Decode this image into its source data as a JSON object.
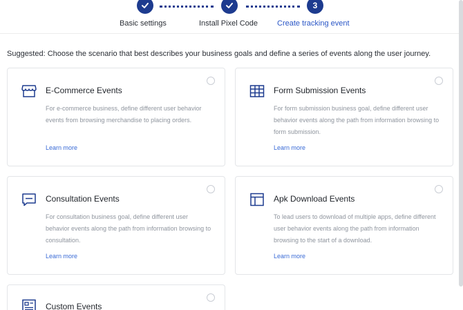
{
  "stepper": {
    "steps": [
      {
        "label": "Basic settings",
        "state": "done"
      },
      {
        "label": "Install Pixel Code",
        "state": "done"
      },
      {
        "label": "Create tracking event",
        "state": "active",
        "number": "3"
      }
    ]
  },
  "suggestion": "Suggested: Choose the scenario that best describes your business goals and define a series of events along the user journey.",
  "cards": [
    {
      "icon": "storefront-icon",
      "title": "E-Commerce Events",
      "description": "For e-commerce business, define different user behavior events from browsing merchandise to placing orders.",
      "learn_more": "Learn more"
    },
    {
      "icon": "table-form-icon",
      "title": "Form Submission Events",
      "description": "For form submission business goal, define different user behavior events along the path from information browsing to form submission.",
      "learn_more": "Learn more"
    },
    {
      "icon": "chat-bubble-icon",
      "title": "Consultation Events",
      "description": "For consultation business goal, define different user behavior events along the path from information browsing to consultation.",
      "learn_more": "Learn more"
    },
    {
      "icon": "layout-panel-icon",
      "title": "Apk Download Events",
      "description": "To lead users to download of multiple apps, define different user behavior events along the path from information browsing to the start of a download.",
      "learn_more": "Learn more"
    },
    {
      "icon": "custom-grid-icon",
      "title": "Custom Events"
    }
  ],
  "colors": {
    "accent": "#1d3b8f",
    "link": "#3a6bd6",
    "border": "#e3e5e8"
  }
}
